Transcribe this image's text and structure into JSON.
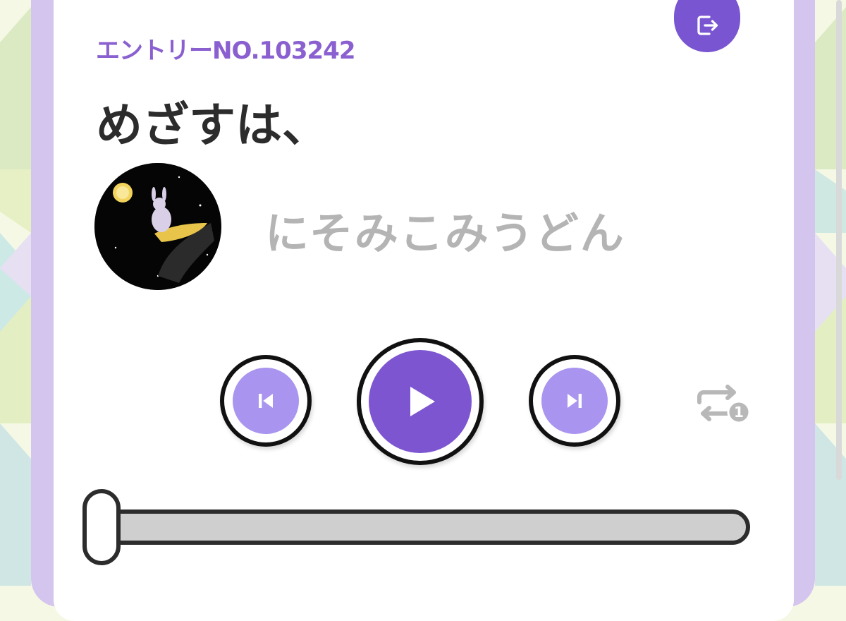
{
  "entry_label": "エントリーNO.103242",
  "song_title": "めざすは、",
  "artist_name": "にそみこみうどん",
  "repeat_badge": "1",
  "progress": 0,
  "icons": {
    "exit": "exit-icon",
    "previous": "skip-previous-icon",
    "play": "play-icon",
    "next": "skip-next-icon",
    "repeat": "repeat-one-icon"
  },
  "colors": {
    "accent": "#7e55d1",
    "accent_light": "#a994ef",
    "frame": "#d4c5ee",
    "muted_text": "#b4b4b4"
  }
}
